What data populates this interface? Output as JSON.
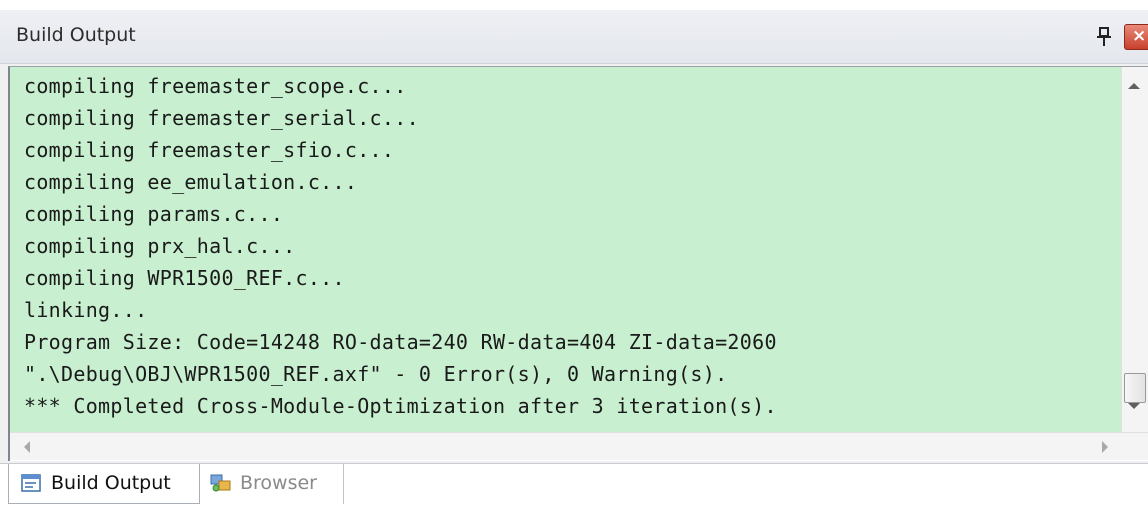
{
  "window": {
    "title": "Build Output"
  },
  "output": {
    "lines": [
      "compiling freemaster_scope.c...",
      "compiling freemaster_serial.c...",
      "compiling freemaster_sfio.c...",
      "compiling ee_emulation.c...",
      "compiling params.c...",
      "compiling prx_hal.c...",
      "compiling WPR1500_REF.c...",
      "linking...",
      "Program Size: Code=14248 RO-data=240 RW-data=404 ZI-data=2060",
      "\".\\Debug\\OBJ\\WPR1500_REF.axf\" - 0 Error(s), 0 Warning(s).",
      "*** Completed Cross-Module-Optimization after 3 iteration(s)."
    ],
    "background_color": "#c8f0d0",
    "vertical_scroll_position": 0.93
  },
  "tabs": [
    {
      "label": "Build Output",
      "icon": "build-output-icon",
      "active": true
    },
    {
      "label": "Browser",
      "icon": "browser-icon",
      "active": false
    }
  ],
  "controls": {
    "pin_icon": "pin-icon",
    "close_icon": "close-icon",
    "close_color": "#c8402c"
  }
}
